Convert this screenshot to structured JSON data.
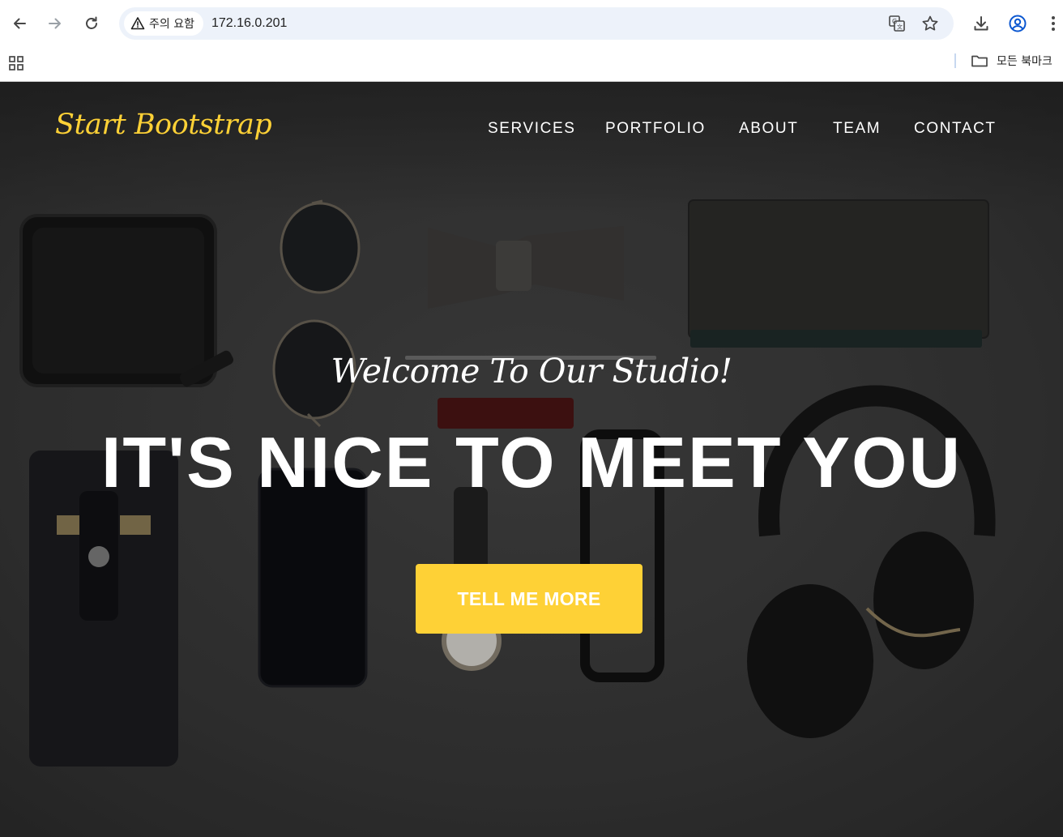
{
  "browser": {
    "security_label": "주의 요함",
    "url": "172.16.0.201",
    "bookmarks_folder_label": "모든 북마크",
    "icons": [
      "back-icon",
      "forward-icon",
      "reload-icon",
      "warning-icon",
      "translate-icon",
      "star-icon",
      "download-icon",
      "profile-icon",
      "menu-icon",
      "apps-icon",
      "folder-icon"
    ]
  },
  "site": {
    "brand": "Start Bootstrap",
    "nav": [
      "SERVICES",
      "PORTFOLIO",
      "ABOUT",
      "TEAM",
      "CONTACT"
    ],
    "hero": {
      "subheading": "Welcome To Our Studio!",
      "heading": "IT'S NICE TO MEET YOU",
      "button": "TELL ME MORE"
    }
  },
  "colors": {
    "accent": "#fed136",
    "hero_text": "#ffffff",
    "omnibox_bg": "#edf2fa",
    "browser_icon": "#474747"
  }
}
